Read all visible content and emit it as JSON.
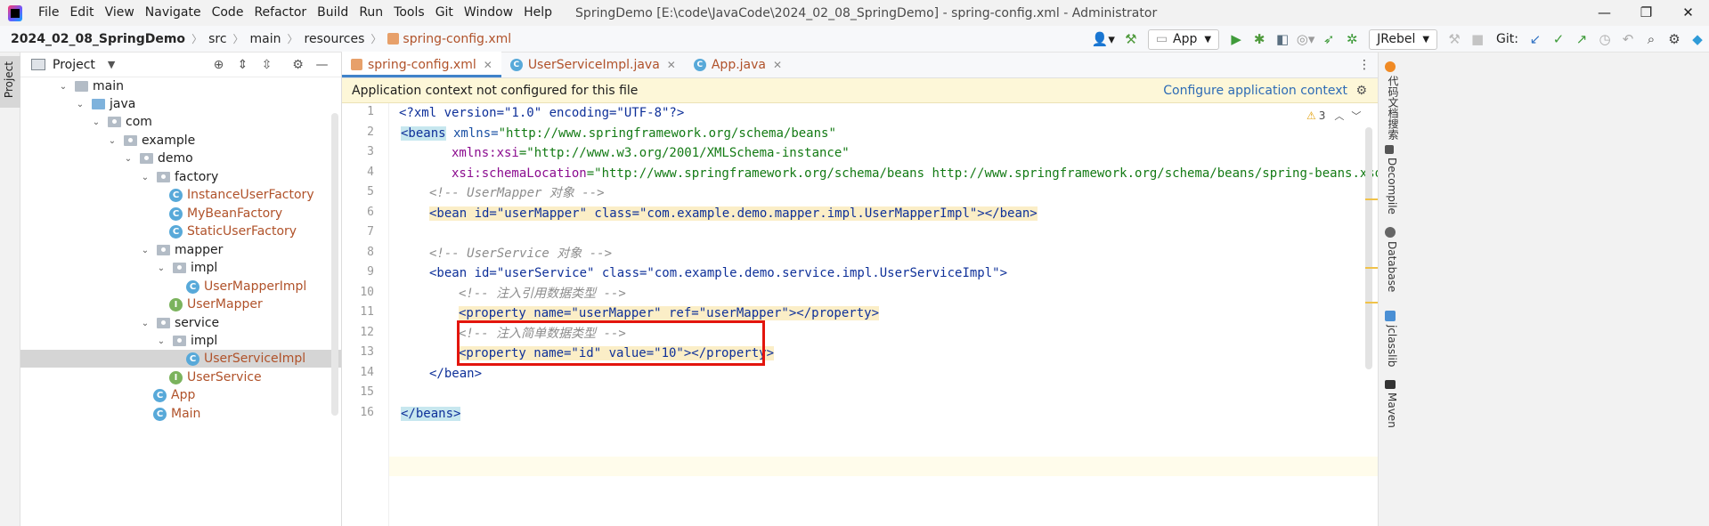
{
  "titlebar": {
    "menu": [
      "File",
      "Edit",
      "View",
      "Navigate",
      "Code",
      "Refactor",
      "Build",
      "Run",
      "Tools",
      "Git",
      "Window",
      "Help"
    ],
    "window_title": "SpringDemo [E:\\code\\JavaCode\\2024_02_08_SpringDemo] - spring-config.xml - Administrator",
    "minimize": "—",
    "restore": "❐",
    "close": "✕"
  },
  "navbar": {
    "crumbs": [
      "2024_02_08_SpringDemo",
      "src",
      "main",
      "resources",
      "spring-config.xml"
    ],
    "run_config": "App",
    "jrebel": "JRebel",
    "git_label": "Git:"
  },
  "project_panel": {
    "title": "Project",
    "tree": [
      {
        "label": "main",
        "kind": "folder"
      },
      {
        "label": "java",
        "kind": "src"
      },
      {
        "label": "com",
        "kind": "pkg"
      },
      {
        "label": "example",
        "kind": "pkg"
      },
      {
        "label": "demo",
        "kind": "pkg"
      },
      {
        "label": "factory",
        "kind": "pkg"
      },
      {
        "label": "InstanceUserFactory",
        "kind": "class"
      },
      {
        "label": "MyBeanFactory",
        "kind": "class"
      },
      {
        "label": "StaticUserFactory",
        "kind": "class"
      },
      {
        "label": "mapper",
        "kind": "pkg"
      },
      {
        "label": "impl",
        "kind": "pkg"
      },
      {
        "label": "UserMapperImpl",
        "kind": "class"
      },
      {
        "label": "UserMapper",
        "kind": "interface"
      },
      {
        "label": "service",
        "kind": "pkg"
      },
      {
        "label": "impl",
        "kind": "pkg"
      },
      {
        "label": "UserServiceImpl",
        "kind": "class",
        "selected": true
      },
      {
        "label": "UserService",
        "kind": "interface"
      },
      {
        "label": "App",
        "kind": "app"
      },
      {
        "label": "Main",
        "kind": "app"
      }
    ]
  },
  "editor": {
    "tabs": [
      {
        "label": "spring-config.xml",
        "icon": "xml-file-icon",
        "active": true
      },
      {
        "label": "UserServiceImpl.java",
        "icon": "class-icon",
        "active": false
      },
      {
        "label": "App.java",
        "icon": "class-icon",
        "active": false
      }
    ],
    "banner": {
      "text": "Application context not configured for this file",
      "link": "Configure application context"
    },
    "warnings": "3",
    "line_numbers": [
      "1",
      "2",
      "3",
      "4",
      "5",
      "6",
      "7",
      "8",
      "9",
      "10",
      "11",
      "12",
      "13",
      "14",
      "15",
      "16"
    ],
    "code": {
      "l1": "<?xml version=\"1.0\" encoding=\"UTF-8\"?>",
      "l2_tag": "<beans",
      "l2_attr": " xmlns=",
      "l2_val": "\"http://www.springframework.org/schema/beans\"",
      "l3_ns": "xmlns:xsi",
      "l3_val": "=\"http://www.w3.org/2001/XMLSchema-instance\"",
      "l4_ns": "xsi:schemaLocation",
      "l4_val": "=\"http://www.springframework.org/schema/beans http://www.springframework.org/schema/beans/spring-beans.xsd\">",
      "l5": "<!-- UserMapper 对象 -->",
      "l6": "<bean id=\"userMapper\" class=\"com.example.demo.mapper.impl.UserMapperImpl\"></bean>",
      "l8": "<!-- UserService 对象 -->",
      "l9": "<bean id=\"userService\" class=\"com.example.demo.service.impl.UserServiceImpl\">",
      "l10": "<!-- 注入引用数据类型 -->",
      "l11": "<property name=\"userMapper\" ref=\"userMapper\"></property>",
      "l12": "<!-- 注入简单数据类型 -->",
      "l13": "<property name=\"id\" value=\"10\"></property>",
      "l14": "</bean>",
      "l16": "</beans>"
    }
  },
  "right_tools": [
    "代码文档搜索",
    "Decompile",
    "Database",
    "jclasslib",
    "Maven"
  ]
}
